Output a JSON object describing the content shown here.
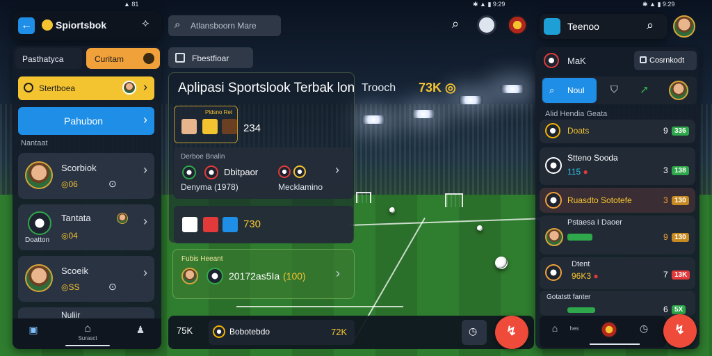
{
  "status_bar": {
    "left_time": "81",
    "center_time": "9:29",
    "right_time": "9:29"
  },
  "left_panel": {
    "app_name": "Spiortsbok",
    "tabs": [
      "Pasthatyca",
      "Curitam"
    ],
    "promo_banner": "Stertboea",
    "primary_button": "Pahubon",
    "section_title": "Nantaat",
    "items": [
      {
        "title": "Scorbiok",
        "odds": "06"
      },
      {
        "title": "Tantata",
        "subtitle": "Doatton",
        "odds": "04"
      },
      {
        "title": "Scoeik",
        "odds": "SS"
      },
      {
        "title": "Nuliir"
      }
    ],
    "bottom_nav": [
      "",
      "Surasct",
      ""
    ]
  },
  "center": {
    "search_placeholder": "Atlansboorn Mare",
    "filter_chip": "Fbestfioar",
    "headline": "Aplipasi Sportslook Terbak lon",
    "secondary_label": "Trooch",
    "secondary_value": "73K",
    "card1": {
      "badge": "Pldsno Ret",
      "value": "234"
    },
    "card2": {
      "title": "Derboe Bnalin",
      "left_label": "Dbitpaor",
      "left_sub": "Denyma (1978)",
      "right_label": "Mecklamino"
    },
    "card3": {
      "value": "730"
    },
    "card4": {
      "title": "Fubis Heeant",
      "value": "20172as5Ia",
      "extra": "(100)"
    },
    "bottom_bar": {
      "left_value": "75K",
      "match_label": "Bobotebdo",
      "right_value": "72K"
    }
  },
  "right_panel": {
    "app_name": "Teenoo",
    "header_label": "MaK",
    "header_button": "Cosrnkodt",
    "active_tab": "Noul",
    "list_header": "Alid Hendia Geata",
    "items": [
      {
        "title": "Doats",
        "score": "9",
        "badge": "336"
      },
      {
        "title": "Stteno Sooda",
        "sub": "115",
        "score": "3",
        "badge": "138"
      },
      {
        "title": "Ruasdto Sototefe",
        "score": "3",
        "badge": "130"
      },
      {
        "title": "Pstaesa I Daoer",
        "score": "9",
        "badge": "130"
      },
      {
        "title": "Dtent",
        "sub": "96K3",
        "score": "7",
        "badge": "13K"
      },
      {
        "title": "Gotatstt fanter",
        "score": "6",
        "badge": "5X"
      }
    ],
    "bottom_nav": [
      "",
      "hes",
      ""
    ]
  },
  "colors": {
    "accent_blue": "#1e8ee6",
    "accent_gold": "#f4c430",
    "accent_orange": "#f0a13a",
    "fab_red": "#ef4b3a",
    "win_green": "#2ea84a"
  }
}
